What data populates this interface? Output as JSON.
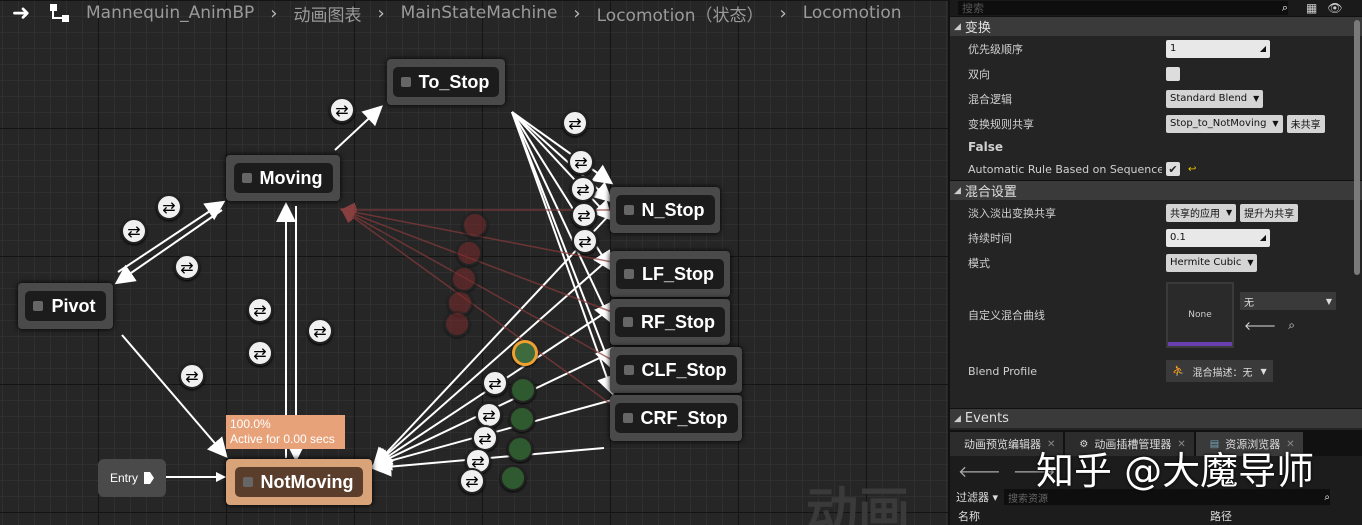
{
  "breadcrumb": [
    "Mannequin_AnimBP",
    "动画图表",
    "MainStateMachine",
    "Locomotion（状态）",
    "Locomotion"
  ],
  "graph": {
    "nodes": {
      "to_stop": "To_Stop",
      "moving": "Moving",
      "pivot": "Pivot",
      "n_stop": "N_Stop",
      "lf_stop": "LF_Stop",
      "rf_stop": "RF_Stop",
      "clf_stop": "CLF_Stop",
      "crf_stop": "CRF_Stop",
      "not_moving": "NotMoving"
    },
    "entry_label": "Entry",
    "active_tip": [
      "100.0%",
      "Active for 0.00 secs"
    ],
    "background_text": "动画"
  },
  "details": {
    "search_placeholder": "搜索",
    "sections": {
      "transition": "变换",
      "blend": "混合设置",
      "events": "Events"
    },
    "rows": {
      "priority_label": "优先级顺序",
      "priority_value": "1",
      "bidirectional_label": "双向",
      "blend_logic_label": "混合逻辑",
      "blend_logic_value": "Standard Blend",
      "rule_share_label": "变换规则共享",
      "rule_share_value": "Stop_to_NotMoving",
      "unshare_button": "未共享",
      "false_label": "False",
      "auto_rule_label": "Automatic Rule Based on Sequence Pla",
      "crossfade_share_label": "淡入淡出变换共享",
      "crossfade_share_value": "共享的应用",
      "promote_button": "提升为共享",
      "duration_label": "持续时间",
      "duration_value": "0.1",
      "mode_label": "模式",
      "mode_value": "Hermite Cubic",
      "curve_label": "自定义混合曲线",
      "curve_none": "None",
      "curve_select": "无",
      "blend_profile_label": "Blend Profile",
      "blend_profile_value": "混合描述：无"
    }
  },
  "bottom": {
    "tabs": [
      "动画预览编辑器",
      "动画插槽管理器",
      "资源浏览器"
    ],
    "filter_label": "过滤器",
    "search_placeholder": "搜索资源",
    "columns": [
      "名称",
      "路径"
    ]
  },
  "watermark": "知乎 @大魔导师",
  "colors": {
    "active_node": "#d9a37a",
    "accent": "#f0a030"
  }
}
